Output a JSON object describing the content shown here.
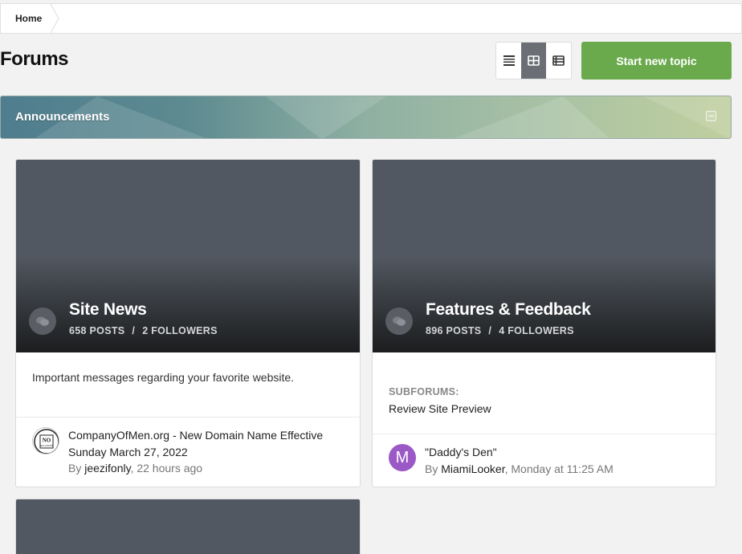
{
  "breadcrumb": {
    "home": "Home"
  },
  "page": {
    "title": "Forums"
  },
  "view_switch": {
    "options": [
      "list-view-icon",
      "grid-view-icon",
      "table-view-icon"
    ],
    "selected": "grid-view-icon"
  },
  "toolbar": {
    "start_topic": "Start new topic"
  },
  "colors": {
    "accent_green": "#6aaa4c",
    "hero_dark": "#1c1d1f",
    "hero_top": "#525861"
  },
  "section": {
    "title": "Announcements"
  },
  "forums": [
    {
      "name": "Site News",
      "posts": "658 POSTS",
      "followers": "2 FOLLOWERS",
      "description": "Important messages regarding your favorite website.",
      "last_post": {
        "title": "CompanyOfMen.org - New Domain Name Effective Sunday March 27, 2022",
        "by_prefix": "By",
        "user": "jeezifonly",
        "time": ", 22 hours ago",
        "avatar_text": "NO ALLOWED"
      }
    },
    {
      "name": "Features & Feedback",
      "posts": "896 POSTS",
      "followers": "4 FOLLOWERS",
      "subforums_label": "SUBFORUMS:",
      "subforums": [
        "Review Site Preview"
      ],
      "last_post": {
        "title": "\"Daddy's Den\"",
        "by_prefix": "By",
        "user": "MiamiLooker",
        "time": ", Monday at 11:25 AM",
        "avatar_letter": "M",
        "avatar_color": "#9b59c6"
      }
    }
  ],
  "stats_separator": "/"
}
